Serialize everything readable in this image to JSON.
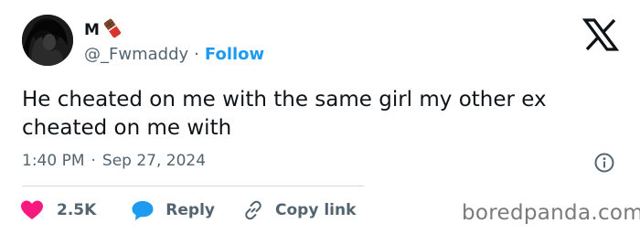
{
  "author": {
    "display_name": "M",
    "handle": "@_Fwmaddy",
    "separator": "·",
    "follow_label": "Follow"
  },
  "tweet": {
    "text": "He cheated on me with the same girl my other ex cheated on me with",
    "time": "1:40 PM",
    "date": "Sep 27, 2024",
    "separator": "·"
  },
  "actions": {
    "like_count": "2.5K",
    "reply_label": "Reply",
    "copy_link_label": "Copy link"
  },
  "watermark": "boredpanda.com",
  "icons": {
    "name_badge": "chocolate-bar-emoji",
    "logo": "x-logo-icon",
    "info": "info-icon",
    "like": "heart-icon",
    "reply": "speech-bubble-icon",
    "copy": "link-icon"
  },
  "colors": {
    "text": "#0f1419",
    "muted": "#536471",
    "follow": "#1d9bf0",
    "heart": "#f91880",
    "reply_bubble": "#1d9bf0",
    "divider": "#cfd9de"
  }
}
